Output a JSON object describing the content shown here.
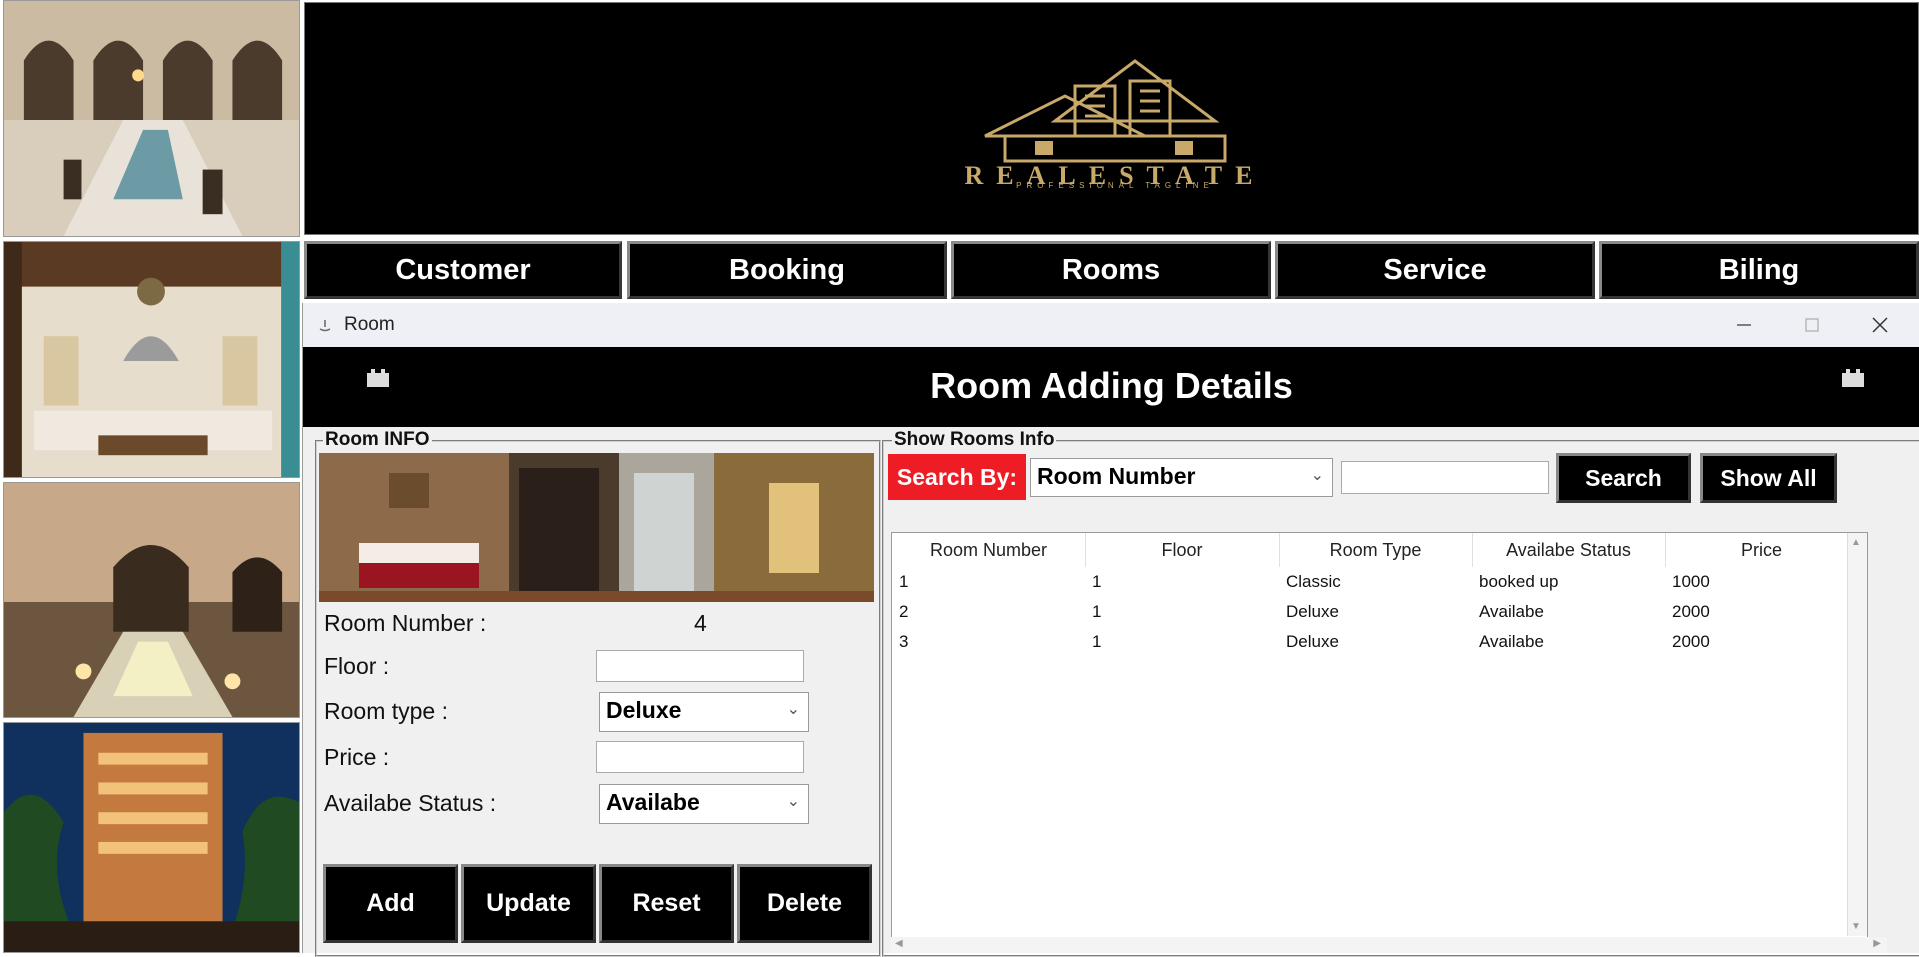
{
  "nav": {
    "customer": "Customer",
    "booking": "Booking",
    "rooms": "Rooms",
    "service": "Service",
    "billing": "Biling"
  },
  "logo": {
    "wordmark": "REALESTATE",
    "tagline": "PROFESSIONAL TAGLINE"
  },
  "window": {
    "title": "Room",
    "banner_title": "Room Adding Details"
  },
  "room_info": {
    "legend": "Room INFO",
    "room_number_label": "Room Number :",
    "room_number_value": "4",
    "floor_label": "Floor :",
    "floor_value": "",
    "room_type_label": "Room type :",
    "room_type_value": "Deluxe",
    "price_label": "Price :",
    "price_value": "",
    "status_label": "Availabe Status :",
    "status_value": "Availabe"
  },
  "actions": {
    "add": "Add",
    "update": "Update",
    "reset": "Reset",
    "delete": "Delete"
  },
  "show_rooms": {
    "legend": "Show Rooms Info",
    "search_by_label": "Search By:",
    "search_by_value": "Room Number",
    "search_text": "",
    "search_button": "Search",
    "show_all_button": "Show All"
  },
  "table": {
    "columns": [
      "Room Number",
      "Floor",
      "Room Type",
      "Availabe Status",
      "Price"
    ],
    "rows": [
      [
        "1",
        "1",
        "Classic",
        "booked up",
        "1000"
      ],
      [
        "2",
        "1",
        "Deluxe",
        "Availabe",
        "2000"
      ],
      [
        "3",
        "1",
        "Deluxe",
        "Availabe",
        "2000"
      ]
    ]
  },
  "colors": {
    "search_label_bg": "#ee1c24",
    "header_bg": "#000000",
    "window_bg": "#f0f0f0",
    "logo_gold": "#c9a96a"
  }
}
